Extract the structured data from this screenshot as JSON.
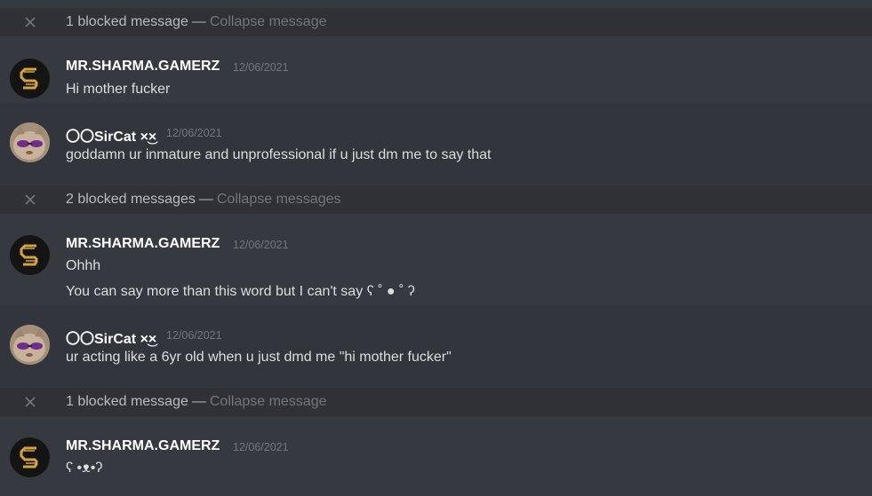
{
  "blocked": [
    {
      "count_text": "1 blocked message",
      "sep": "—",
      "collapse": "Collapse message"
    },
    {
      "count_text": "2 blocked messages",
      "sep": "—",
      "collapse": "Collapse messages"
    },
    {
      "count_text": "1 blocked message",
      "sep": "—",
      "collapse": "Collapse message"
    }
  ],
  "messages": [
    {
      "author": "MR.SHARMA.GAMERZ",
      "timestamp": "12/06/2021",
      "lines": [
        "Hi mother fucker"
      ]
    },
    {
      "author": "〇〇SirCat ×͜×",
      "timestamp": "12/06/2021",
      "lines": [
        "goddamn ur inmature and unprofessional if u just dm me to say that"
      ]
    },
    {
      "author": "MR.SHARMA.GAMERZ",
      "timestamp": "12/06/2021",
      "lines": [
        "Ohhh",
        "You can say more than this word  but I can't say ʕ ˚ ● ˚ ʔ"
      ]
    },
    {
      "author": "〇〇SirCat ×͜×",
      "timestamp": "12/06/2021",
      "lines": [
        "ur acting like a 6yr old when u just dmd me \"hi mother fucker\""
      ]
    },
    {
      "author": "MR.SHARMA.GAMERZ",
      "timestamp": "12/06/2021",
      "lines": [
        "ʕ •ᴥ•ʔ"
      ]
    }
  ],
  "colors": {
    "background": "#36393f",
    "blocked_bar": "#2f3136",
    "username": "#ffffff",
    "timestamp": "#72767d",
    "sharma_logo": "#d4a437"
  }
}
